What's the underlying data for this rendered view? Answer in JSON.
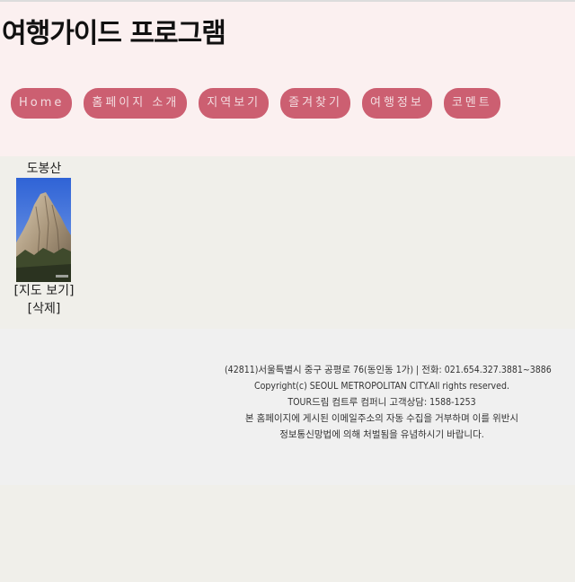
{
  "header": {
    "title": "여행가이드 프로그램"
  },
  "nav": {
    "items": [
      {
        "label": "Home"
      },
      {
        "label": "홈페이지 소개"
      },
      {
        "label": "지역보기"
      },
      {
        "label": "즐겨찾기"
      },
      {
        "label": "여행정보"
      },
      {
        "label": "코멘트"
      }
    ]
  },
  "places": [
    {
      "name": "도봉산",
      "map_link": "[지도 보기]",
      "delete_link": "[삭제]"
    }
  ],
  "footer": {
    "lines": [
      "(42811)서울특별시 중구 공평로 76(동인동 1가) | 전화: 021.654.327.3881~3886",
      "Copyright(c) SEOUL METROPOLITAN CITY.All rights reserved.",
      "TOUR드림 컴트루 컴퍼니 고객상담: 1588-1253",
      "본 홈페이지에 게시된 이메일주소의 자동 수집을 거부하며 이를 위반시",
      "정보통신망법에 의해 처벌됨을 유념하시기 바랍니다."
    ]
  },
  "colors": {
    "header_bg": "#fbf0f0",
    "nav_button_bg": "#cc5f71",
    "nav_button_text": "#f3dce0",
    "body_bg": "#f0efea",
    "footer_bg": "#f0f0f0"
  }
}
